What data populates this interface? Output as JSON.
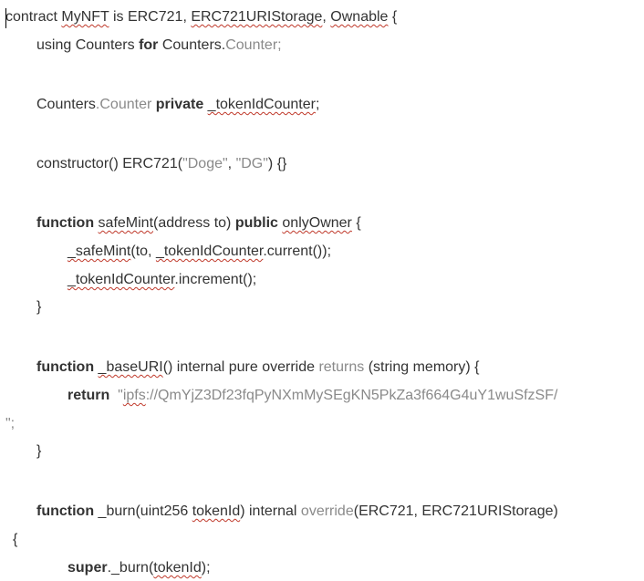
{
  "code": {
    "l1": {
      "t1": "contract ",
      "t2": "MyNFT",
      "t3": " is ",
      "t4": "ERC721",
      "t5": ", ",
      "t6": "ERC721URIStorage",
      "t7": ", ",
      "t8": "Ownable",
      "t9": " {"
    },
    "l2": {
      "t1": "using ",
      "t2": "Counters",
      "t3": " for ",
      "t4": "Counters",
      "t5": ".",
      "t6": "Counter",
      "t7": ";"
    },
    "l3": {
      "t1": "Counters",
      "t2": ".",
      "t3": "Counter",
      "t4": " ",
      "t5": "private",
      "t6": " ",
      "t7": "_tokenIdCounter",
      "t8": ";"
    },
    "l4": {
      "t1": "constructor() ",
      "t2": "ERC721",
      "t3": "(",
      "t4": "\"Doge\"",
      "t5": ", ",
      "t6": "\"DG\"",
      "t7": ") {}"
    },
    "l5": {
      "t1": "function",
      "t2": " ",
      "t3": "safeMint",
      "t4": "(address to) ",
      "t5": "public",
      "t6": " ",
      "t7": "onlyOwner",
      "t8": " {"
    },
    "l6": {
      "t1": "_safeMint",
      "t2": "(to, ",
      "t3": "_tokenIdCounter",
      "t4": ".current());"
    },
    "l7": {
      "t1": "_tokenIdCounter",
      "t2": ".increment();"
    },
    "l8": {
      "t1": "}"
    },
    "l9": {
      "t1": "function",
      "t2": " ",
      "t3": "_baseURI",
      "t4": "() internal pure override ",
      "t5": "returns",
      "t6": " (string memory) {"
    },
    "l10": {
      "t1": "return",
      "t2": "  \"",
      "t3": "ipfs",
      "t4": "://QmYjZ3Df23fqPyNXmMySEgKN5PkZa3f664G4uY1wuSfzSF/"
    },
    "l11": {
      "t1": "\";"
    },
    "l12": {
      "t1": "}"
    },
    "l13": {
      "t1": "function",
      "t2": " _burn(uint256 ",
      "t3": "tokenId",
      "t4": ") internal ",
      "t5": "override",
      "t6": "(ERC721, ERC721URIStorage)"
    },
    "l14": {
      "t1": "{"
    },
    "l15": {
      "t1": "super",
      "t2": "._burn(",
      "t3": "tokenId",
      "t4": ");"
    }
  }
}
